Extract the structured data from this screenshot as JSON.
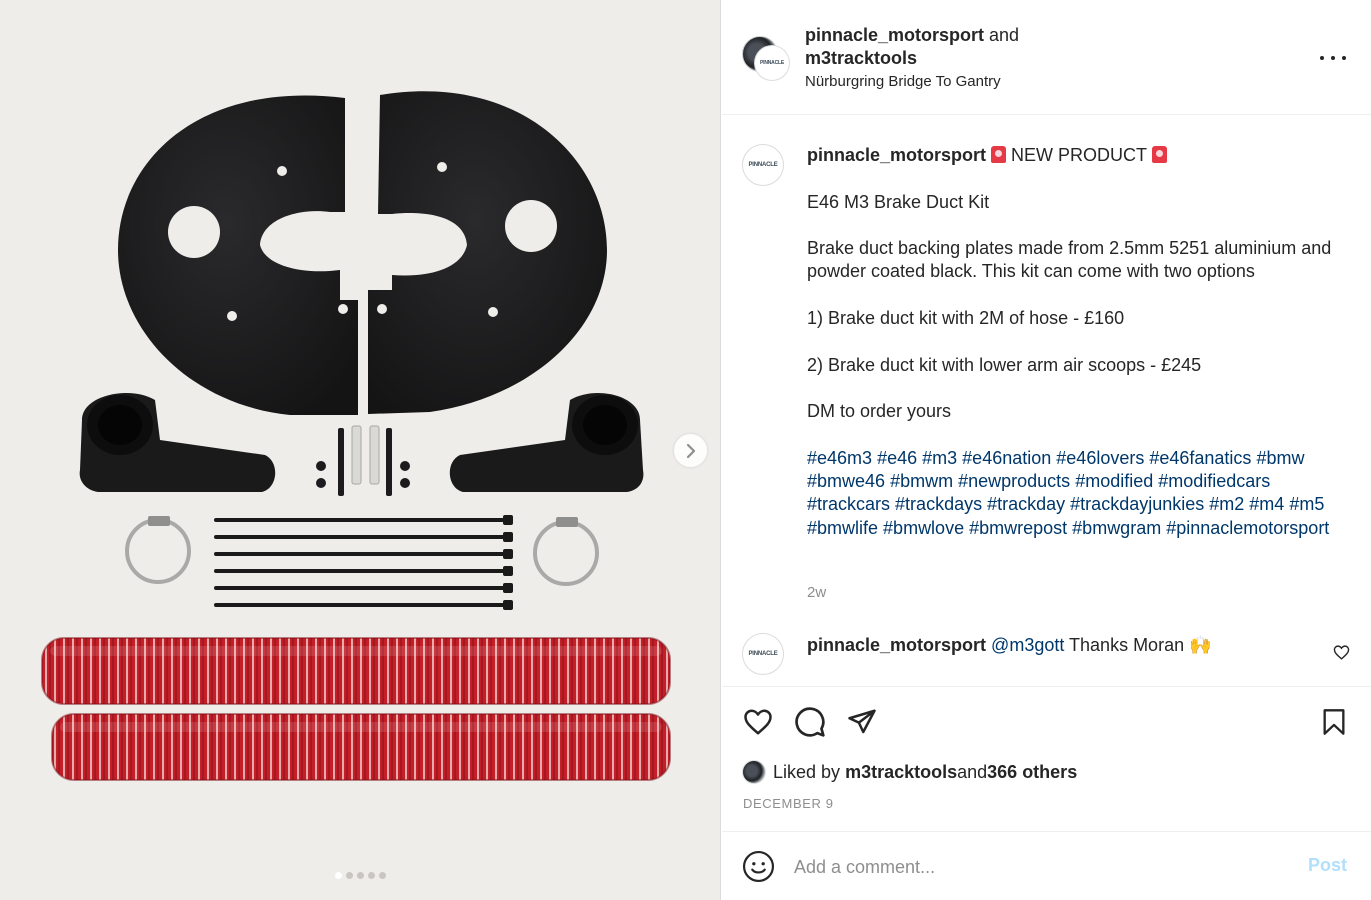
{
  "header": {
    "user1": "pinnacle_motorsport",
    "conj": " and ",
    "user2": "m3tracktools",
    "location": "Nürburgring Bridge To Gantry",
    "avatar_logo": "PINNACLE"
  },
  "caption": {
    "avatar_logo": "PINNACLE",
    "user": "pinnacle_motorsport",
    "headline": " NEW PRODUCT ",
    "title": "E46 M3 Brake Duct Kit",
    "line1": "Brake duct backing plates made from 2.5mm 5251 aluminium and powder coated black. This kit can come with two options",
    "option1": "1) Brake duct kit with 2M of hose - £160",
    "option2": "2) Brake duct kit with lower arm air scoops - £245",
    "cta": "DM to order yours",
    "hashtags": [
      "#e46m3",
      "#e46",
      "#m3",
      "#e46nation",
      "#e46lovers",
      "#e46fanatics",
      "#bmw",
      "#bmwe46",
      "#bmwm",
      "#newproducts",
      "#modified",
      "#modifiedcars",
      "#trackcars",
      "#trackdays",
      "#trackday",
      "#trackdayjunkies",
      "#m2",
      "#m4",
      "#m5",
      "#bmwlife",
      "#bmwlove",
      "#bmwrepost",
      "#bmwgram",
      "#pinnaclemotorsport"
    ],
    "time_ago": "2w"
  },
  "reply": {
    "avatar_logo": "PINNACLE",
    "user": "pinnacle_motorsport",
    "mention": "@m3gott",
    "text": " Thanks Moran 🙌"
  },
  "likes": {
    "prefix": "Liked by ",
    "user": "m3tracktools",
    "mid": " and ",
    "others": "366 others"
  },
  "date": "DECEMBER 9",
  "comment_box": {
    "placeholder": "Add a comment...",
    "post_label": "Post"
  },
  "carousel": {
    "total": 5,
    "active_index": 0
  },
  "colors": {
    "hose_red": "#c8202a",
    "plate_black": "#1c1c1e",
    "link_blue": "#00376b",
    "post_disabled": "#b2dffc"
  },
  "icons": [
    "more-icon",
    "heart-icon",
    "comment-icon",
    "share-icon",
    "bookmark-icon",
    "emoji-icon",
    "chevron-right-icon",
    "siren-icon"
  ]
}
